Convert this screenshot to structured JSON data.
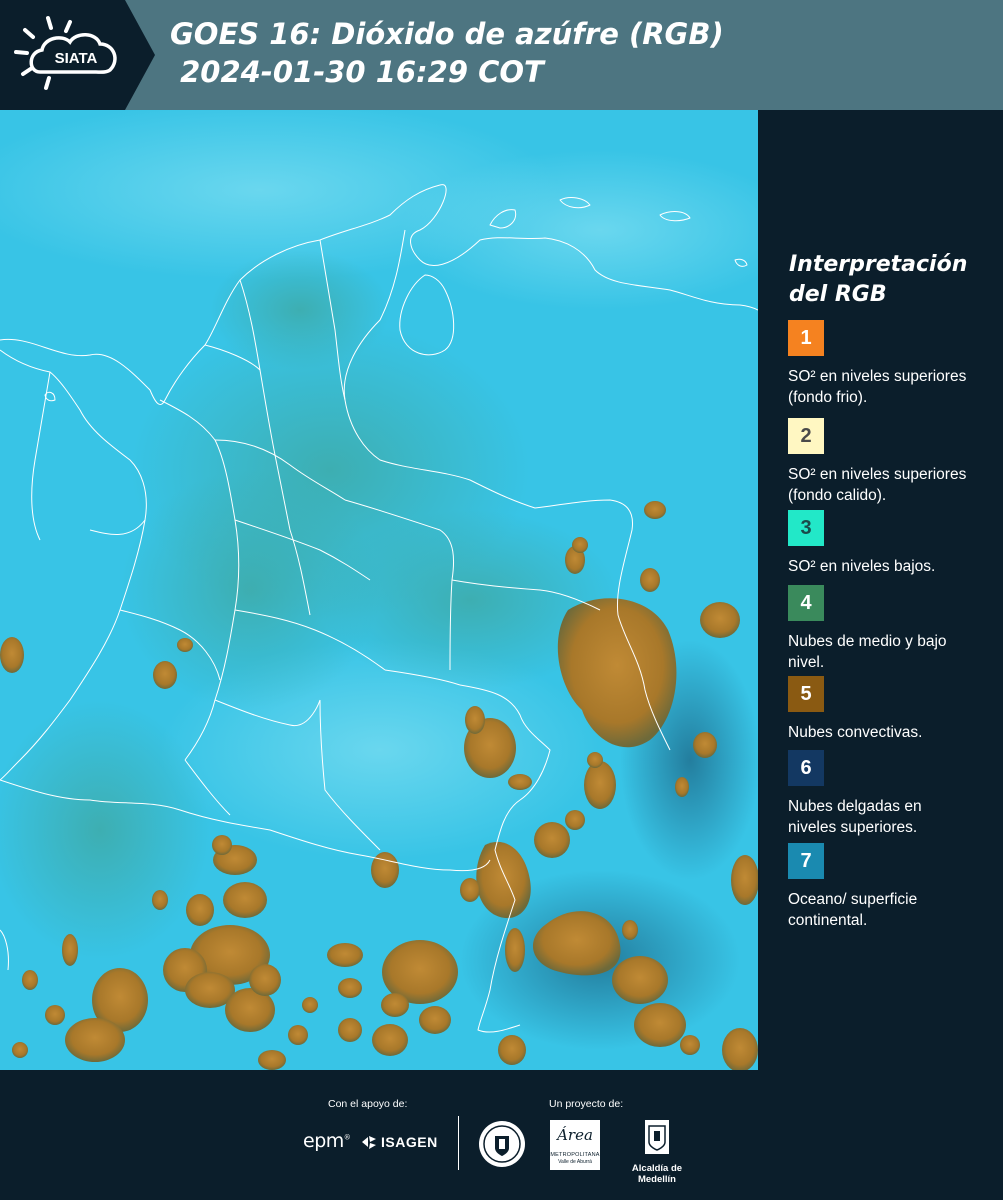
{
  "header": {
    "logo_text": "SIATA",
    "title_line1": "GOES 16: Dióxido de azúfre (RGB)",
    "title_line2": " 2024-01-30 16:29 COT"
  },
  "legend": {
    "title_line1": "Interpretación",
    "title_line2": "del RGB",
    "items": [
      {
        "number": "1",
        "color": "#f58220",
        "num_color": "#ffffff",
        "text": "SO² en niveles superiores (fondo frio)."
      },
      {
        "number": "2",
        "color": "#fff7c2",
        "num_color": "#4a4a4a",
        "text": "SO² en niveles superiores (fondo calido)."
      },
      {
        "number": "3",
        "color": "#22e8c8",
        "num_color": "#1a4a4a",
        "text": "SO² en niveles bajos."
      },
      {
        "number": "4",
        "color": "#3a8a5c",
        "num_color": "#ffffff",
        "text": "Nubes de medio y bajo nivel."
      },
      {
        "number": "5",
        "color": "#8a5a12",
        "num_color": "#ffffff",
        "text": "Nubes convectivas."
      },
      {
        "number": "6",
        "color": "#133862",
        "num_color": "#ffffff",
        "text": "Nubes delgadas en niveles superiores."
      },
      {
        "number": "7",
        "color": "#1a8ab0",
        "num_color": "#ffffff",
        "text": "Oceano/ superficie continental."
      }
    ]
  },
  "footer": {
    "support_label": "Con el apoyo de:",
    "project_label": "Un proyecto de:",
    "sponsor_epm": "epm",
    "sponsor_isagen": "ISAGEN",
    "area_word": "Área",
    "area_sub": "METROPOLITANA",
    "area_sub2": "Valle de Aburrá",
    "alcaldia": "Alcaldía de Medellín"
  },
  "colors": {
    "background": "#0b1e2b",
    "header_band": "#4d7581",
    "map_ocean": "#34c6e6",
    "cloud_convective": "#a8782a"
  }
}
